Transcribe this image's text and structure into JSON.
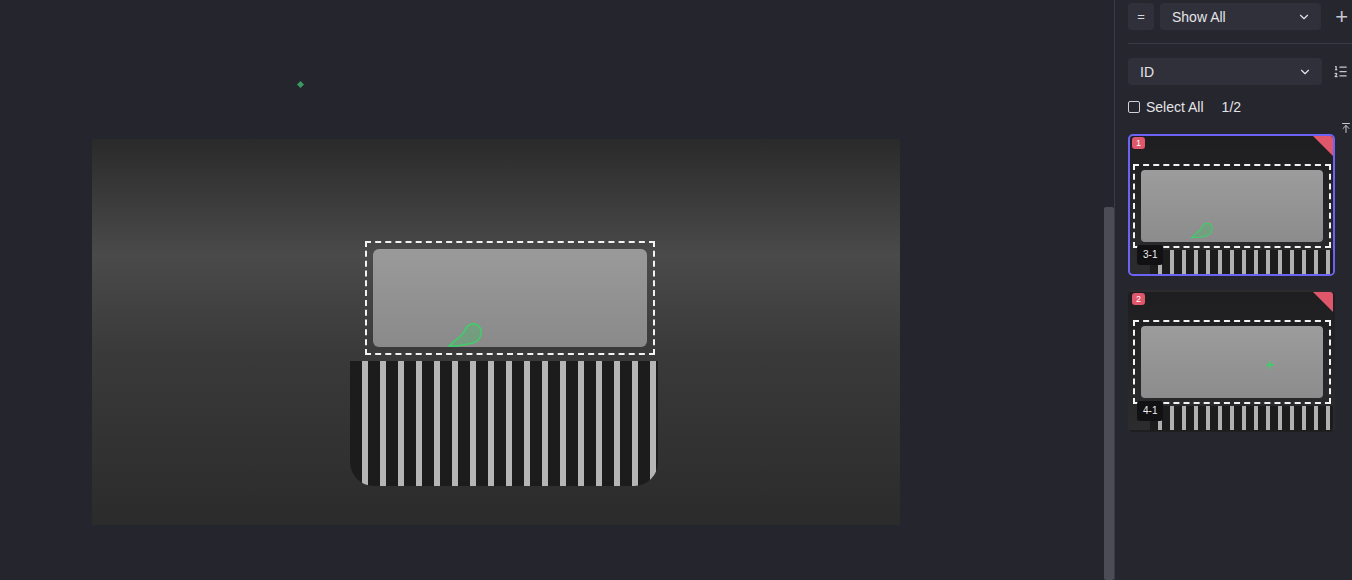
{
  "toolbar": {
    "filter_mode": "=",
    "filter": "Show All",
    "add": "+"
  },
  "sort": {
    "field": "ID"
  },
  "select_all": {
    "label": "Select All",
    "checked": false,
    "count": "1/2"
  },
  "viewer": {
    "mark_kind": "blob"
  },
  "cards": [
    {
      "index": "1",
      "label": "3-1",
      "selected": true,
      "flagged": true,
      "mark_kind": "blob"
    },
    {
      "index": "2",
      "label": "4-1",
      "selected": false,
      "flagged": true,
      "mark_kind": "dot"
    }
  ]
}
